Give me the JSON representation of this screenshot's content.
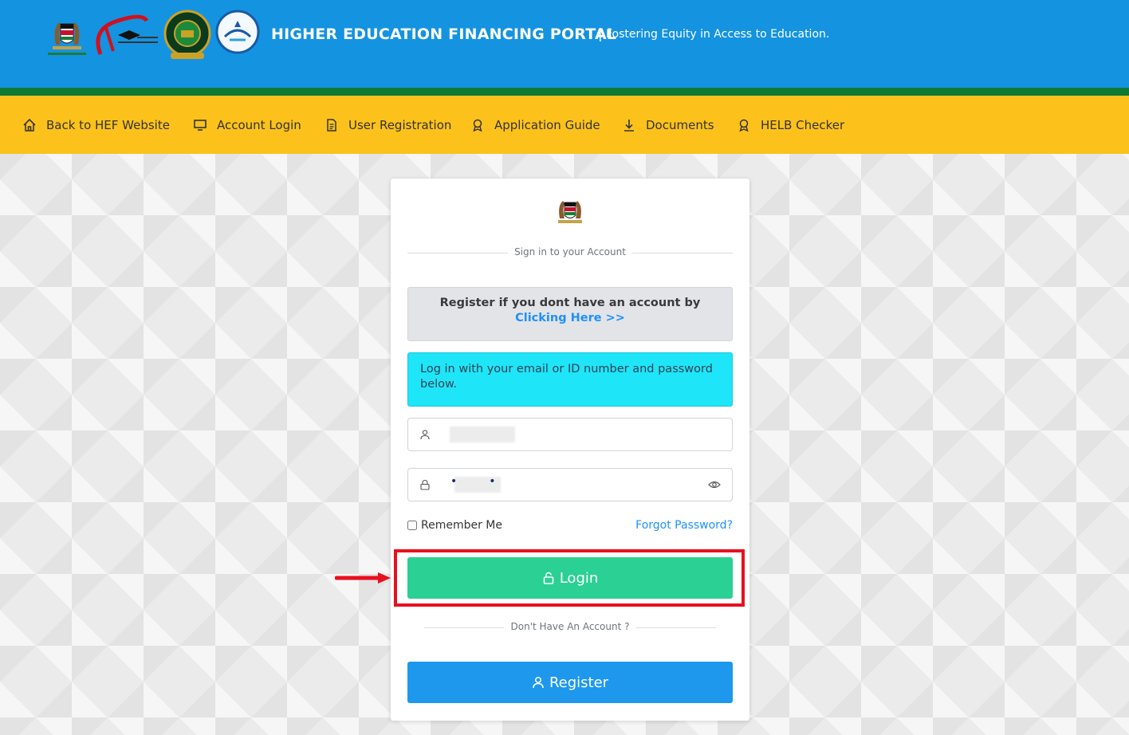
{
  "header": {
    "title": "HIGHER EDUCATION FINANCING PORTAL",
    "separator": "|",
    "tagline": "Fostering Equity in Access to Education.",
    "logos": [
      "kenya-coat-of-arms-logo",
      "ministry-of-education-logo",
      "helb-logo",
      "universities-fund-logo"
    ]
  },
  "nav": {
    "items": [
      {
        "label": "Back to HEF Website",
        "icon": "home-icon"
      },
      {
        "label": "Account Login",
        "icon": "monitor-icon"
      },
      {
        "label": "User Registration",
        "icon": "document-icon"
      },
      {
        "label": "Application Guide",
        "icon": "award-icon"
      },
      {
        "label": "Documents",
        "icon": "download-icon"
      },
      {
        "label": "HELB Checker",
        "icon": "award-icon"
      }
    ]
  },
  "login": {
    "signin_text": "Sign in to your Account",
    "register_alert": {
      "text": "Register if you dont have an account by ",
      "link": "Clicking Here >>"
    },
    "info_text": "Log in with your email or ID number and password below.",
    "username": {
      "value": ""
    },
    "password": {
      "value": "",
      "masked_display": "•         •"
    },
    "remember_label": "Remember Me",
    "forgot_label": "Forgot Password?",
    "login_label": "Login",
    "no_account_text": "Don't Have An Account ?",
    "register_label": "Register"
  },
  "colors": {
    "header_blue": "#1493e0",
    "stripe_green": "#0f7a35",
    "nav_yellow": "#fcc21b",
    "login_green": "#2ad094",
    "register_blue": "#1d98ed",
    "info_cyan": "#1fe5f8",
    "highlight_red": "#e8101f"
  }
}
